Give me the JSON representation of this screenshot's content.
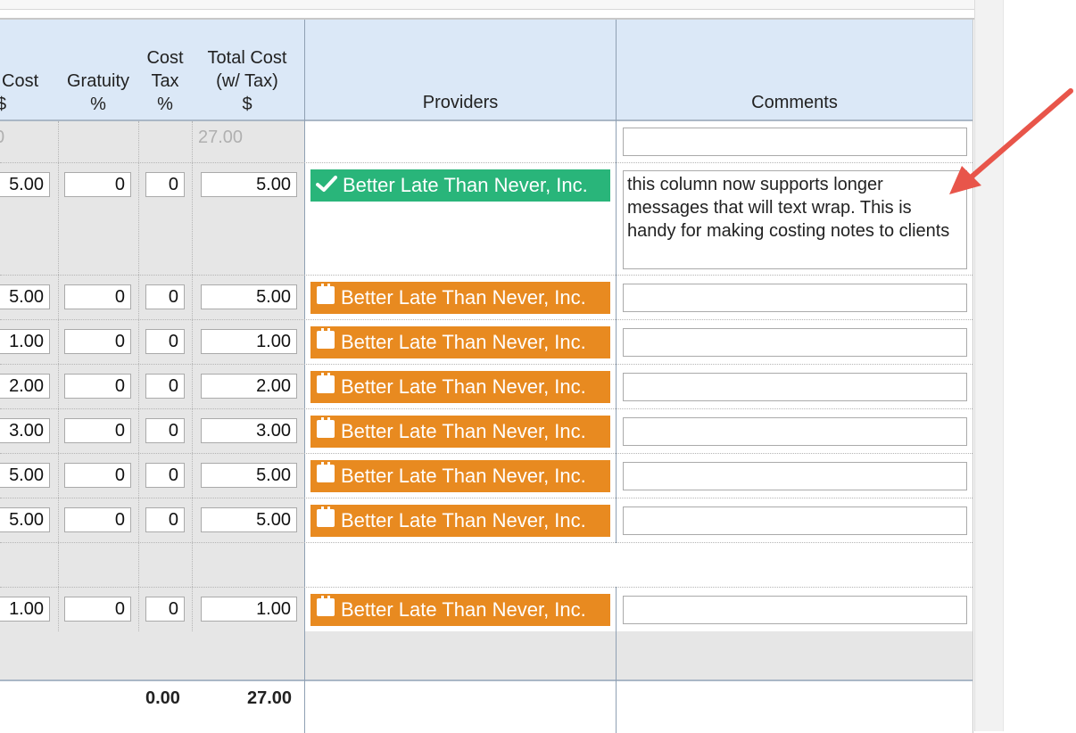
{
  "columns": {
    "cost_partial": "Cost",
    "cost_partial_unit": "$",
    "gratuity": "Gratuity",
    "gratuity_unit": "%",
    "cost_tax_line1": "Cost",
    "cost_tax_line2": "Tax",
    "cost_tax_unit": "%",
    "total_cost_line1": "Total Cost",
    "total_cost_line2": "(w/ Tax)",
    "total_cost_unit": "$",
    "providers": "Providers",
    "comments": "Comments"
  },
  "top_row": {
    "partial_ghost": "0",
    "total_ghost": "27.00",
    "comment": ""
  },
  "rows": [
    {
      "cost": "5.00",
      "gratuity": "0",
      "tax": "0",
      "total": "5.00",
      "provider": "Better Late Than Never, Inc.",
      "status": "confirmed",
      "comment": "this column now supports longer messages that will text wrap. This is handy for making costing notes to clients"
    },
    {
      "cost": "5.00",
      "gratuity": "0",
      "tax": "0",
      "total": "5.00",
      "provider": "Better Late Than Never, Inc.",
      "status": "scheduled",
      "comment": ""
    },
    {
      "cost": "1.00",
      "gratuity": "0",
      "tax": "0",
      "total": "1.00",
      "provider": "Better Late Than Never, Inc.",
      "status": "scheduled",
      "comment": ""
    },
    {
      "cost": "2.00",
      "gratuity": "0",
      "tax": "0",
      "total": "2.00",
      "provider": "Better Late Than Never, Inc.",
      "status": "scheduled",
      "comment": ""
    },
    {
      "cost": "3.00",
      "gratuity": "0",
      "tax": "0",
      "total": "3.00",
      "provider": "Better Late Than Never, Inc.",
      "status": "scheduled",
      "comment": ""
    },
    {
      "cost": "5.00",
      "gratuity": "0",
      "tax": "0",
      "total": "5.00",
      "provider": "Better Late Than Never, Inc.",
      "status": "scheduled",
      "comment": ""
    },
    {
      "cost": "5.00",
      "gratuity": "0",
      "tax": "0",
      "total": "5.00",
      "provider": "Better Late Than Never, Inc.",
      "status": "scheduled",
      "comment": ""
    },
    {
      "cost": "1.00",
      "gratuity": "0",
      "tax": "0",
      "total": "1.00",
      "provider": "Better Late Than Never, Inc.",
      "status": "scheduled",
      "comment": ""
    }
  ],
  "footer": {
    "tax_total": "0.00",
    "grand_total": "27.00"
  },
  "colors": {
    "header_bg": "#dbe8f7",
    "confirmed_green": "#29b57a",
    "scheduled_orange": "#e88a20",
    "annotation_red": "#e8554a"
  },
  "icons": {
    "confirmed": "checkmark-icon",
    "scheduled": "calendar-icon",
    "annotation": "arrow-annotation"
  }
}
